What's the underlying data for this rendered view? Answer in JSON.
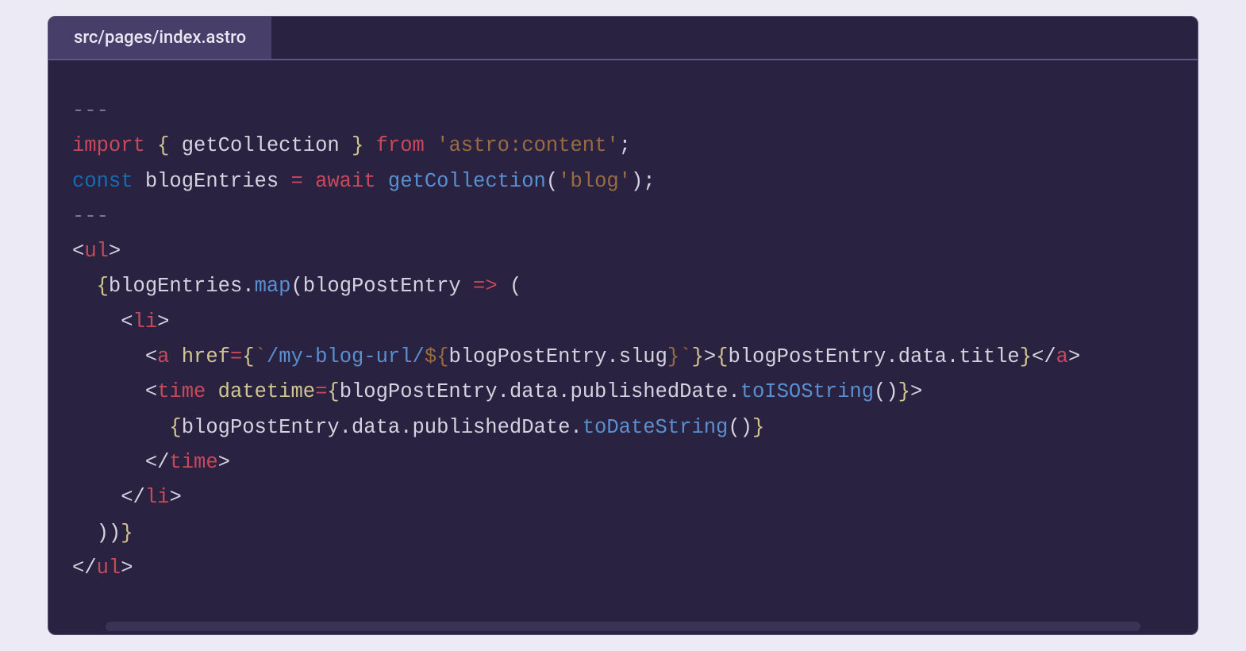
{
  "tab": {
    "filename": "src/pages/index.astro"
  },
  "code": {
    "lines": [
      {
        "segments": [
          {
            "cls": "tk-frontmatter",
            "text": "---"
          }
        ]
      },
      {
        "segments": [
          {
            "cls": "tk-keyword",
            "text": "import"
          },
          {
            "cls": "tk-default",
            "text": " "
          },
          {
            "cls": "tk-brace",
            "text": "{"
          },
          {
            "cls": "tk-default",
            "text": " getCollection "
          },
          {
            "cls": "tk-brace",
            "text": "}"
          },
          {
            "cls": "tk-default",
            "text": " "
          },
          {
            "cls": "tk-keyword",
            "text": "from"
          },
          {
            "cls": "tk-default",
            "text": " "
          },
          {
            "cls": "tk-string",
            "text": "'astro:content'"
          },
          {
            "cls": "tk-default",
            "text": ";"
          }
        ]
      },
      {
        "segments": [
          {
            "cls": "tk-keyword2",
            "text": "const"
          },
          {
            "cls": "tk-default",
            "text": " blogEntries "
          },
          {
            "cls": "tk-op",
            "text": "="
          },
          {
            "cls": "tk-default",
            "text": " "
          },
          {
            "cls": "tk-keyword",
            "text": "await"
          },
          {
            "cls": "tk-default",
            "text": " "
          },
          {
            "cls": "tk-func",
            "text": "getCollection"
          },
          {
            "cls": "tk-default",
            "text": "("
          },
          {
            "cls": "tk-string",
            "text": "'blog'"
          },
          {
            "cls": "tk-default",
            "text": ");"
          }
        ]
      },
      {
        "segments": [
          {
            "cls": "tk-frontmatter",
            "text": "---"
          }
        ]
      },
      {
        "segments": [
          {
            "cls": "tk-default",
            "text": "<"
          },
          {
            "cls": "tk-tag",
            "text": "ul"
          },
          {
            "cls": "tk-default",
            "text": ">"
          }
        ]
      },
      {
        "segments": [
          {
            "cls": "tk-default",
            "text": "  "
          },
          {
            "cls": "tk-brace",
            "text": "{"
          },
          {
            "cls": "tk-default",
            "text": "blogEntries."
          },
          {
            "cls": "tk-method",
            "text": "map"
          },
          {
            "cls": "tk-default",
            "text": "(blogPostEntry "
          },
          {
            "cls": "tk-op",
            "text": "=>"
          },
          {
            "cls": "tk-default",
            "text": " ("
          }
        ]
      },
      {
        "segments": [
          {
            "cls": "tk-default",
            "text": "    <"
          },
          {
            "cls": "tk-tag",
            "text": "li"
          },
          {
            "cls": "tk-default",
            "text": ">"
          }
        ]
      },
      {
        "segments": [
          {
            "cls": "tk-default",
            "text": "      <"
          },
          {
            "cls": "tk-tag",
            "text": "a"
          },
          {
            "cls": "tk-default",
            "text": " "
          },
          {
            "cls": "tk-attr",
            "text": "href"
          },
          {
            "cls": "tk-op",
            "text": "="
          },
          {
            "cls": "tk-brace",
            "text": "{"
          },
          {
            "cls": "tk-string",
            "text": "`"
          },
          {
            "cls": "tk-method",
            "text": "/my-blog-url/"
          },
          {
            "cls": "tk-string",
            "text": "${"
          },
          {
            "cls": "tk-default",
            "text": "blogPostEntry.slug"
          },
          {
            "cls": "tk-string",
            "text": "}`"
          },
          {
            "cls": "tk-brace",
            "text": "}"
          },
          {
            "cls": "tk-default",
            "text": ">"
          },
          {
            "cls": "tk-brace",
            "text": "{"
          },
          {
            "cls": "tk-default",
            "text": "blogPostEntry.data.title"
          },
          {
            "cls": "tk-brace",
            "text": "}"
          },
          {
            "cls": "tk-default",
            "text": "</"
          },
          {
            "cls": "tk-tag",
            "text": "a"
          },
          {
            "cls": "tk-default",
            "text": ">"
          }
        ]
      },
      {
        "segments": [
          {
            "cls": "tk-default",
            "text": "      <"
          },
          {
            "cls": "tk-tag",
            "text": "time"
          },
          {
            "cls": "tk-default",
            "text": " "
          },
          {
            "cls": "tk-attr",
            "text": "datetime"
          },
          {
            "cls": "tk-op",
            "text": "="
          },
          {
            "cls": "tk-brace",
            "text": "{"
          },
          {
            "cls": "tk-default",
            "text": "blogPostEntry.data.publishedDate."
          },
          {
            "cls": "tk-method",
            "text": "toISOString"
          },
          {
            "cls": "tk-default",
            "text": "()"
          },
          {
            "cls": "tk-brace",
            "text": "}"
          },
          {
            "cls": "tk-default",
            "text": ">"
          }
        ]
      },
      {
        "segments": [
          {
            "cls": "tk-default",
            "text": "        "
          },
          {
            "cls": "tk-brace",
            "text": "{"
          },
          {
            "cls": "tk-default",
            "text": "blogPostEntry.data.publishedDate."
          },
          {
            "cls": "tk-method",
            "text": "toDateString"
          },
          {
            "cls": "tk-default",
            "text": "()"
          },
          {
            "cls": "tk-brace",
            "text": "}"
          }
        ]
      },
      {
        "segments": [
          {
            "cls": "tk-default",
            "text": "      </"
          },
          {
            "cls": "tk-tag",
            "text": "time"
          },
          {
            "cls": "tk-default",
            "text": ">"
          }
        ]
      },
      {
        "segments": [
          {
            "cls": "tk-default",
            "text": "    </"
          },
          {
            "cls": "tk-tag",
            "text": "li"
          },
          {
            "cls": "tk-default",
            "text": ">"
          }
        ]
      },
      {
        "segments": [
          {
            "cls": "tk-default",
            "text": "  ))"
          },
          {
            "cls": "tk-brace",
            "text": "}"
          }
        ]
      },
      {
        "segments": [
          {
            "cls": "tk-default",
            "text": "</"
          },
          {
            "cls": "tk-tag",
            "text": "ul"
          },
          {
            "cls": "tk-default",
            "text": ">"
          }
        ]
      }
    ]
  }
}
